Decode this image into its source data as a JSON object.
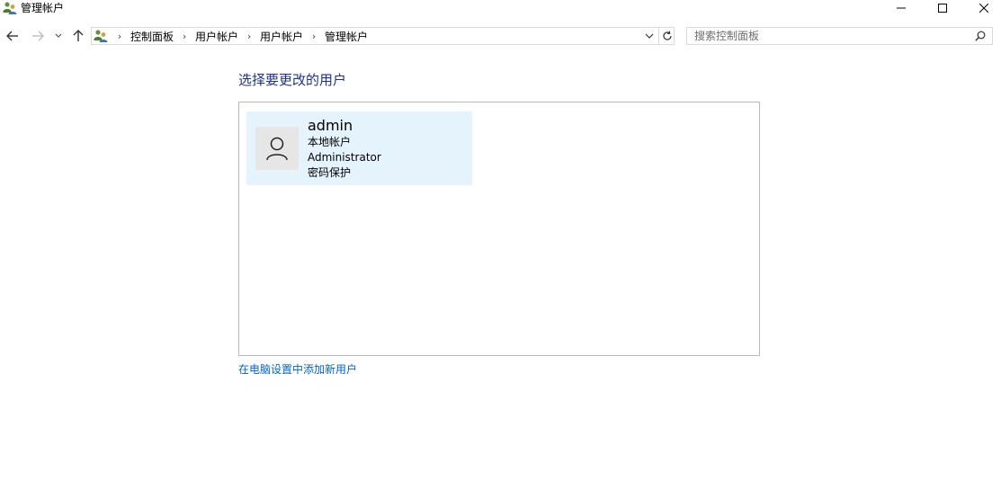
{
  "window": {
    "title": "管理帐户",
    "app_icon": "users-icon"
  },
  "nav": {
    "breadcrumbs": [
      "控制面板",
      "用户帐户",
      "用户帐户",
      "管理帐户"
    ],
    "search_placeholder": "搜索控制面板"
  },
  "main": {
    "heading": "选择要更改的用户",
    "accounts": [
      {
        "name": "admin",
        "type": "本地帐户",
        "role": "Administrator",
        "protection": "密码保护",
        "avatar_icon": "user-icon"
      }
    ],
    "add_user_link": "在电脑设置中添加新用户"
  },
  "colors": {
    "heading": "#1e3287",
    "link": "#0066cc",
    "tile_background": "#e5f3fd",
    "avatar_background": "#e6e6e6"
  }
}
